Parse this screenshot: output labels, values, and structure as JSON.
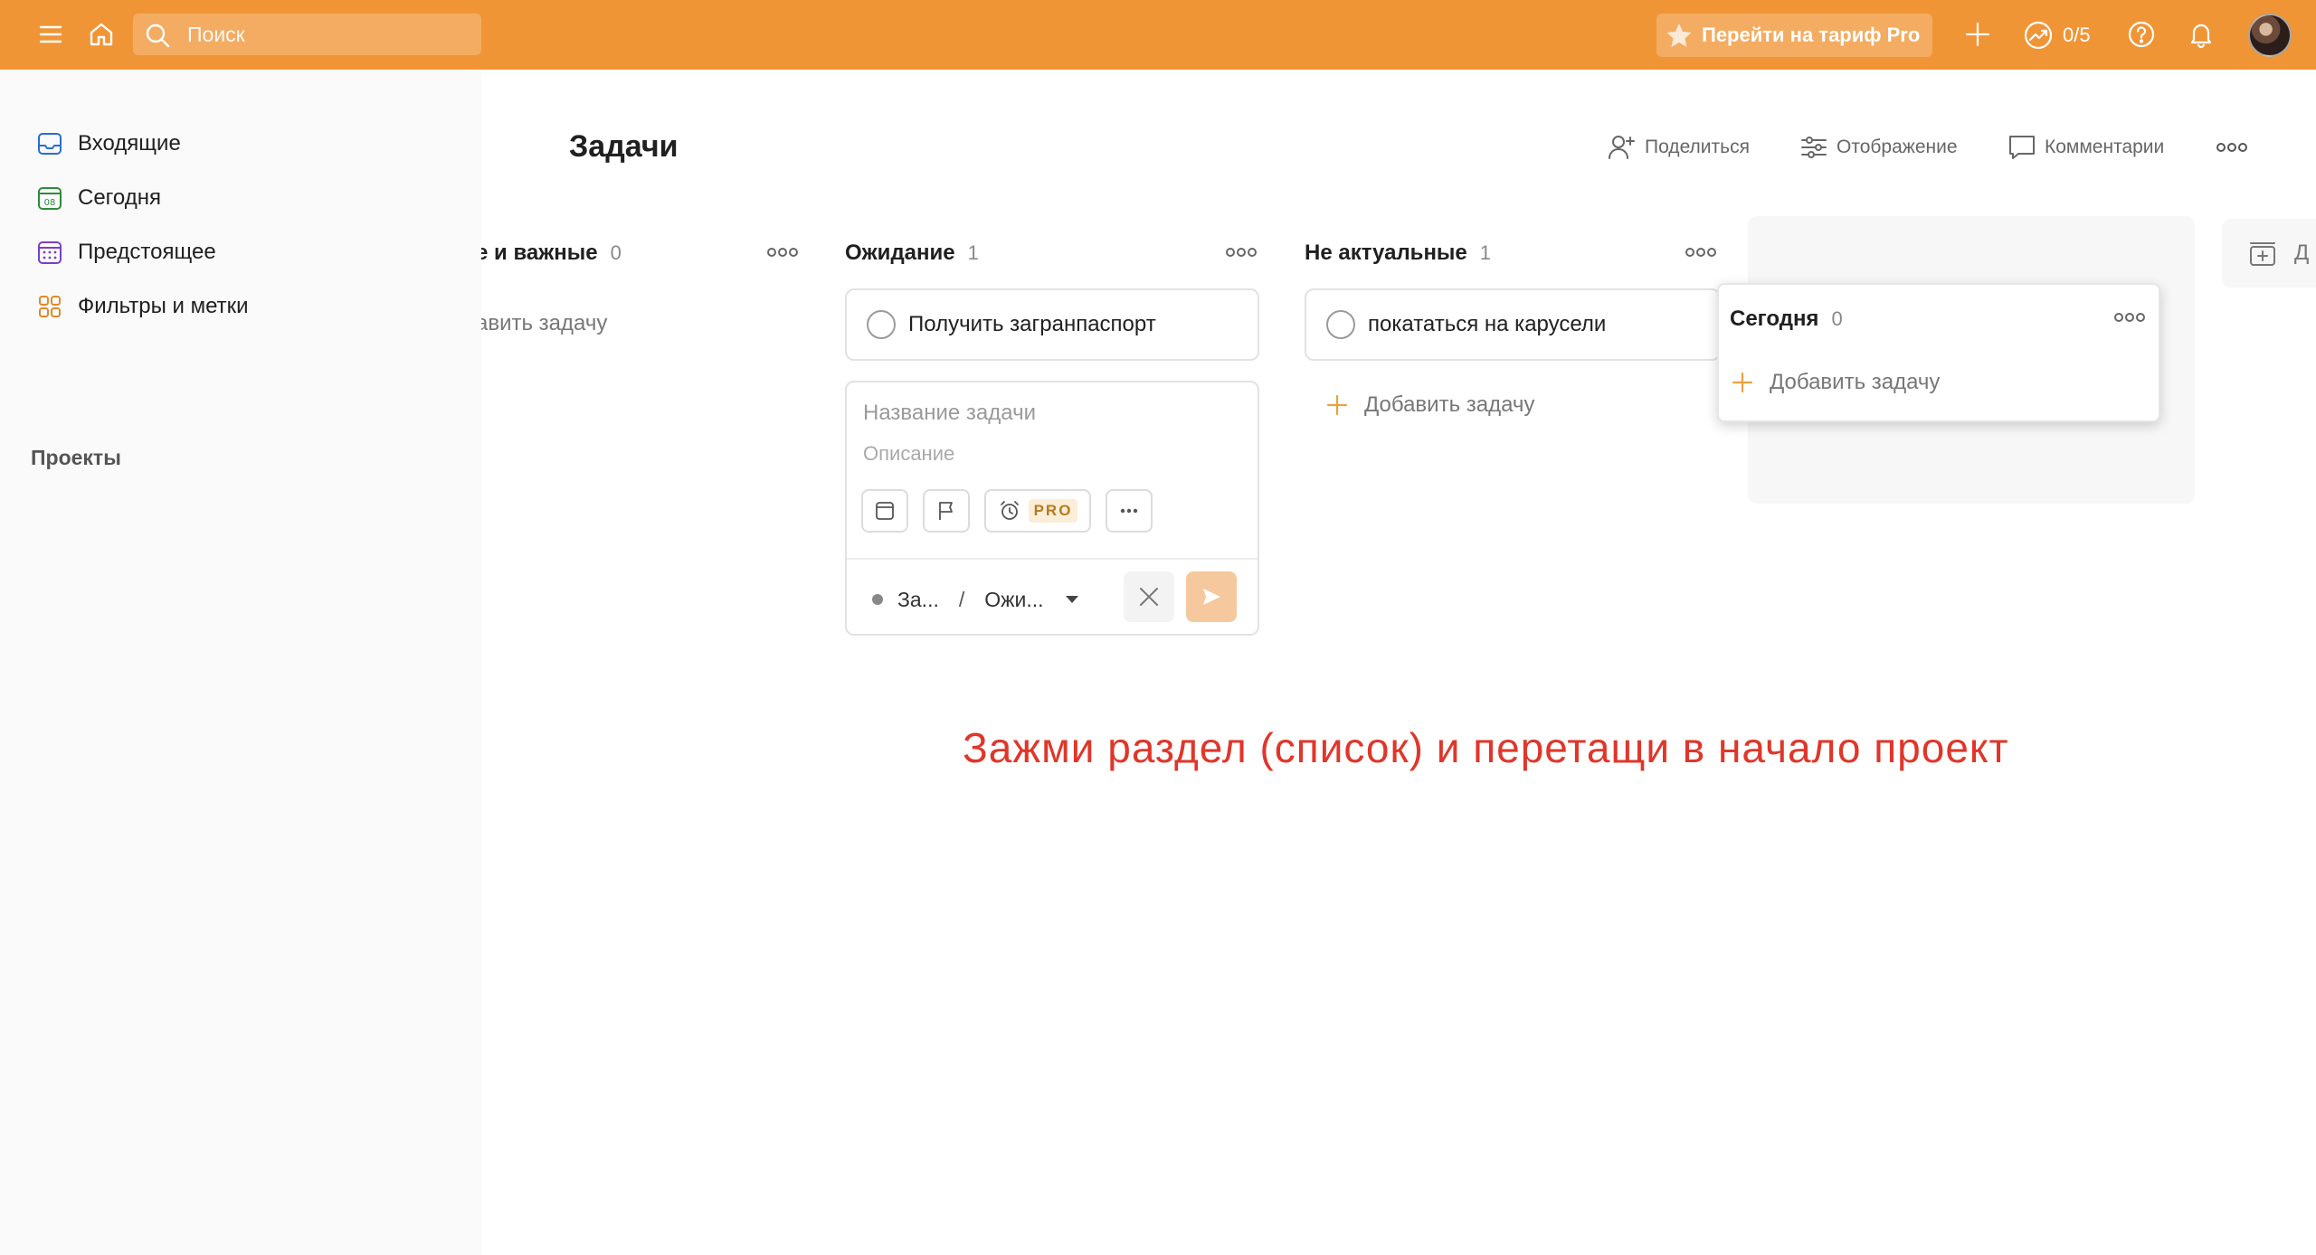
{
  "topbar": {
    "search_placeholder": "Поиск",
    "upgrade_label": "Перейти на тариф Pro",
    "karma_text": "0/5"
  },
  "sidebar": {
    "items": [
      {
        "label": "Входящие",
        "icon": "inbox-icon"
      },
      {
        "label": "Сегодня",
        "icon": "calendar-today-icon",
        "day": "08"
      },
      {
        "label": "Предстоящее",
        "icon": "calendar-upcoming-icon"
      },
      {
        "label": "Фильтры и метки",
        "icon": "filters-icon"
      }
    ],
    "projects_label": "Проекты"
  },
  "main": {
    "title": "Задачи",
    "actions": {
      "share": "Поделиться",
      "view": "Отображение",
      "comments": "Комментарии"
    },
    "sections": [
      {
        "name": "е и важные",
        "count": "0",
        "add_label": "авить задачу"
      },
      {
        "name": "Ожидание",
        "count": "1",
        "task": "Получить загранпаспорт"
      },
      {
        "name": "Не актуальные",
        "count": "1",
        "task": "покататься на карусели",
        "add_label": "Добавить задачу"
      }
    ],
    "editor": {
      "title_placeholder": "Название задачи",
      "description_placeholder": "Описание",
      "pro_badge": "PRO",
      "project_short": "За...",
      "separator": "/",
      "section_short": "Ожи..."
    },
    "dragged_section": {
      "name": "Сегодня",
      "count": "0",
      "add_label": "Добавить задачу"
    },
    "add_section_label": "Д"
  },
  "annotation": "Зажми раздел (список) и перетащи в начало проект",
  "colors": {
    "accent": "#f09536",
    "annotation": "#e0362a",
    "add_icon": "#e8a23c"
  }
}
